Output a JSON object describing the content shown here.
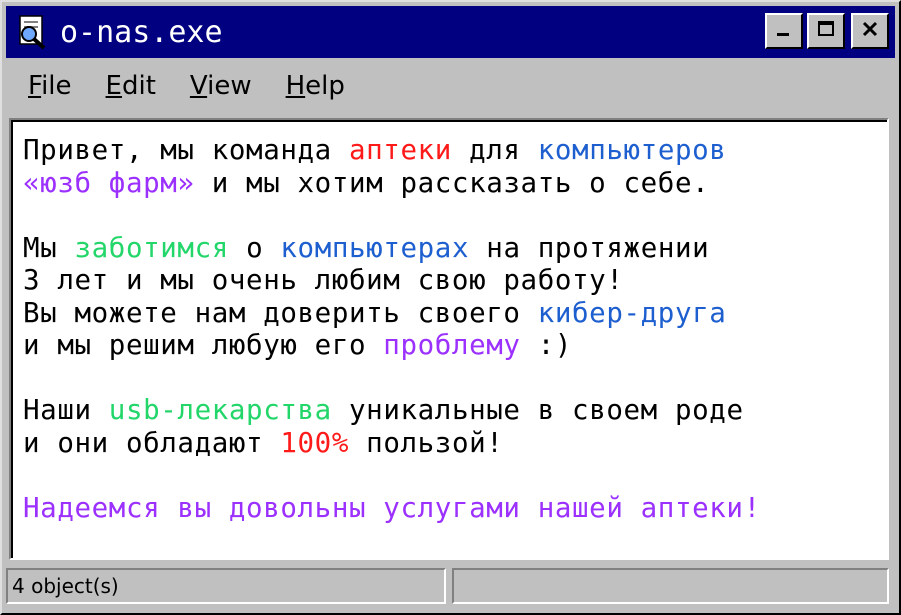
{
  "window": {
    "title": "o-nas.exe",
    "icon": "search-document-icon",
    "controls": [
      "minimize-icon",
      "maximize-icon",
      "close-icon"
    ]
  },
  "menu": {
    "items": [
      {
        "label": "File",
        "accel": "F"
      },
      {
        "label": "Edit",
        "accel": "E"
      },
      {
        "label": "View",
        "accel": "V"
      },
      {
        "label": "Help",
        "accel": "H"
      }
    ]
  },
  "content": {
    "paragraphs": [
      [
        [
          {
            "text": "Привет, мы команда ",
            "color": "#000000"
          },
          {
            "text": "аптеки",
            "color": "#ff1a1a"
          },
          {
            "text": " для ",
            "color": "#000000"
          },
          {
            "text": "компьютеров",
            "color": "#1e5fd0"
          }
        ],
        [
          {
            "text": "«юзб фарм»",
            "color": "#9b30ff"
          },
          {
            "text": " и мы хотим рассказать о себе.",
            "color": "#000000"
          }
        ]
      ],
      [
        [
          {
            "text": "Мы ",
            "color": "#000000"
          },
          {
            "text": "заботимся",
            "color": "#22d66a"
          },
          {
            "text": " о ",
            "color": "#000000"
          },
          {
            "text": "компьютерах",
            "color": "#1e5fd0"
          },
          {
            "text": " на протяжении",
            "color": "#000000"
          }
        ],
        [
          {
            "text": "3 лет и мы очень любим свою работу!",
            "color": "#000000"
          }
        ],
        [
          {
            "text": "Вы можете нам доверить своего ",
            "color": "#000000"
          },
          {
            "text": "кибер-друга",
            "color": "#1e5fd0"
          }
        ],
        [
          {
            "text": "и мы решим любую его ",
            "color": "#000000"
          },
          {
            "text": "проблему",
            "color": "#9b30ff"
          },
          {
            "text": " :)",
            "color": "#000000"
          }
        ]
      ],
      [
        [
          {
            "text": "Наши ",
            "color": "#000000"
          },
          {
            "text": "usb-лекарства",
            "color": "#22d66a"
          },
          {
            "text": " уникальные в своем роде",
            "color": "#000000"
          }
        ],
        [
          {
            "text": "и они обладают ",
            "color": "#000000"
          },
          {
            "text": "100%",
            "color": "#ff1a1a"
          },
          {
            "text": " пользой!",
            "color": "#000000"
          }
        ]
      ],
      [
        [
          {
            "text": "Надеемся вы довольны услугами нашей аптеки!",
            "color": "#9b30ff"
          }
        ]
      ]
    ]
  },
  "status": {
    "left": "4 object(s)",
    "right": ""
  },
  "colors": {
    "titlebar": "#000080",
    "face": "#c0c0c0"
  }
}
